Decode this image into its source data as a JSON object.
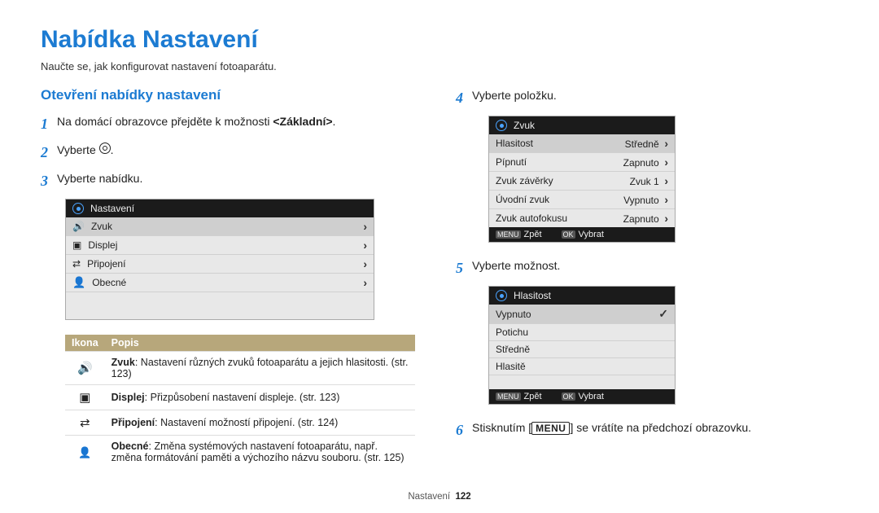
{
  "title": "Nabídka Nastavení",
  "intro": "Naučte se, jak konfigurovat nastavení fotoaparátu.",
  "subtitle": "Otevření nabídky nastavení",
  "steps": {
    "s1_pre": "Na domácí obrazovce přejděte k možnosti ",
    "s1_bold": "<Základní>",
    "s1_post": ".",
    "s2_pre": "Vyberte ",
    "s2_post": ".",
    "s3": "Vyberte nabídku.",
    "s4": "Vyberte položku.",
    "s5": "Vyberte možnost.",
    "s6_pre": "Stisknutím [",
    "s6_key": "MENU",
    "s6_post": "] se vrátíte na předchozí obrazovku."
  },
  "screen1": {
    "header": "Nastavení",
    "items": [
      "Zvuk",
      "Displej",
      "Připojení",
      "Obecné"
    ]
  },
  "screen2": {
    "header": "Zvuk",
    "rows": [
      {
        "label": "Hlasitost",
        "value": "Středně",
        "sel": true
      },
      {
        "label": "Pípnutí",
        "value": "Zapnuto"
      },
      {
        "label": "Zvuk závěrky",
        "value": "Zvuk 1"
      },
      {
        "label": "Úvodní zvuk",
        "value": "Vypnuto"
      },
      {
        "label": "Zvuk autofokusu",
        "value": "Zapnuto"
      }
    ],
    "foot_back_key": "MENU",
    "foot_back": "Zpět",
    "foot_ok_key": "OK",
    "foot_ok": "Vybrat"
  },
  "screen3": {
    "header": "Hlasitost",
    "rows": [
      {
        "label": "Vypnuto",
        "sel": true
      },
      {
        "label": "Potichu"
      },
      {
        "label": "Středně"
      },
      {
        "label": "Hlasitě"
      }
    ],
    "foot_back_key": "MENU",
    "foot_back": "Zpět",
    "foot_ok_key": "OK",
    "foot_ok": "Vybrat"
  },
  "table": {
    "head_icon": "Ikona",
    "head_desc": "Popis",
    "rows": [
      {
        "bold": "Zvuk",
        "text": ": Nastavení různých zvuků fotoaparátu a jejich hlasitosti. (str. 123)"
      },
      {
        "bold": "Displej",
        "text": ": Přizpůsobení nastavení displeje. (str. 123)"
      },
      {
        "bold": "Připojení",
        "text": ": Nastavení možností připojení. (str. 124)"
      },
      {
        "bold": "Obecné",
        "text": ": Změna systémových nastavení fotoaparátu, např. změna formátování paměti a výchozího názvu souboru. (str. 125)"
      }
    ]
  },
  "footer": {
    "section": "Nastavení",
    "page": "122"
  }
}
